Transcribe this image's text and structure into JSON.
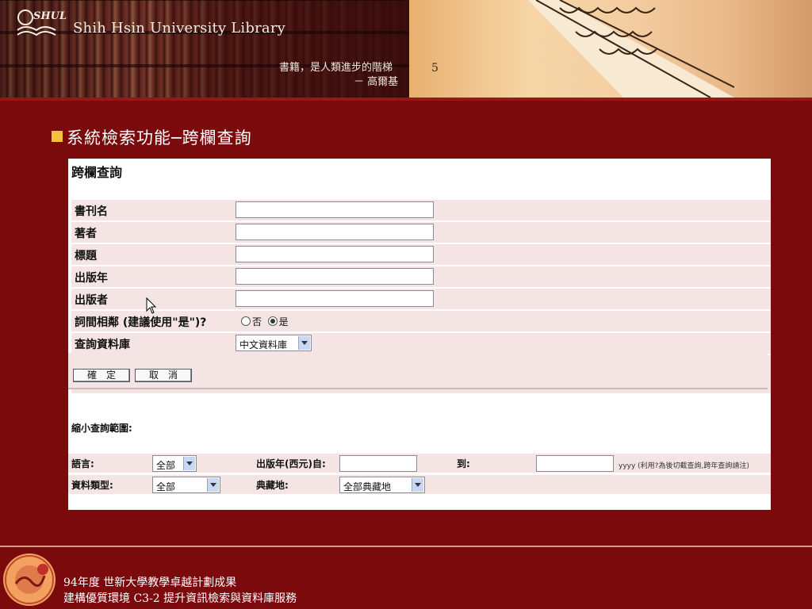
{
  "banner": {
    "library_name": "Shih Hsin University Library",
    "logo_text": "SHUL",
    "quote_line1": "書籍，是人類進步的階梯",
    "quote_line2": "－ 高爾基",
    "sign_text": "5"
  },
  "slide": {
    "title": "系統檢索功能─跨欄查詢"
  },
  "form": {
    "title": "跨欄查詢",
    "fields": [
      {
        "label": "書刊名",
        "value": ""
      },
      {
        "label": "著者",
        "value": ""
      },
      {
        "label": "標題",
        "value": ""
      },
      {
        "label": "出版年",
        "value": ""
      },
      {
        "label": "出版者",
        "value": ""
      }
    ],
    "adjacency": {
      "label": "詞間相鄰 (建議使用\"是\")?",
      "option_no": "否",
      "option_yes": "是",
      "selected": "是"
    },
    "database": {
      "label": "查詢資料庫",
      "selected": "中文資料庫"
    },
    "confirm_button": "確　定",
    "cancel_button": "取　消"
  },
  "narrow": {
    "title": "縮小查詢範圍:",
    "language_label": "語言:",
    "language_selected": "全部",
    "year_from_label": "出版年(西元)自:",
    "year_from_value": "",
    "year_to_label": "到:",
    "year_to_value": "",
    "year_note": "yyyy (利用?為後切截查詢,跨年查詢請注)",
    "type_label": "資料類型:",
    "type_selected": "全部",
    "location_label": "典藏地:",
    "location_selected": "全部典藏地"
  },
  "footer": {
    "line1": "94年度 世新大學教學卓越計劃成果",
    "line2": "建構優質環境 C3-2 提升資訊檢索與資料庫服務"
  },
  "colors": {
    "background": "#7a0a0c",
    "bullet": "#f2c33a",
    "row_bg": "#f4e4e4"
  }
}
